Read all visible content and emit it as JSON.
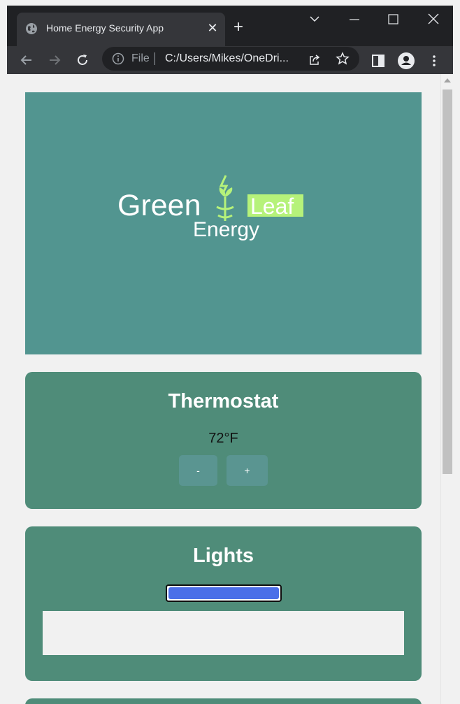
{
  "browser": {
    "tab_title": "Home Energy Security App",
    "omnibox_scheme": "File",
    "omnibox_url": "C:/Users/Mikes/OneDri..."
  },
  "hero": {
    "logo_word1": "Green",
    "logo_word2": "Leaf",
    "logo_word3": "Energy",
    "background_color": "#529590"
  },
  "thermostat": {
    "title": "Thermostat",
    "temperature": "72°F",
    "decrease_label": "-",
    "increase_label": "+"
  },
  "lights": {
    "title": "Lights",
    "brightness_level": 1.0
  },
  "colors": {
    "card": "#4f8c79",
    "accent_green": "#b6f27a",
    "slider": "#4b6fe8"
  }
}
